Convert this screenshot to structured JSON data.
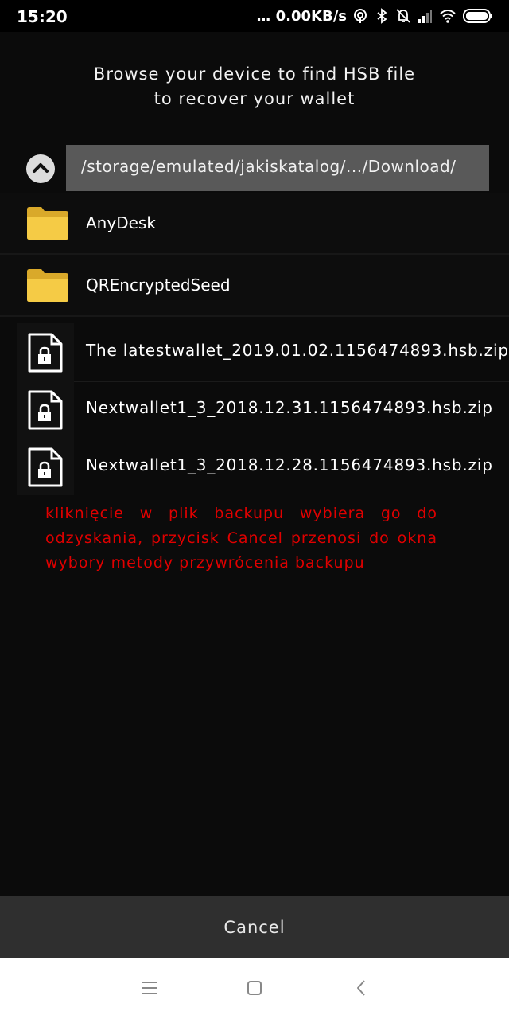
{
  "status_bar": {
    "time": "15:20",
    "dots": "...",
    "net_speed": "0.00KB/s",
    "icons": [
      "hotspot-icon",
      "bluetooth-icon",
      "notifications-off-icon",
      "signal-icon",
      "wifi-icon",
      "battery-icon"
    ]
  },
  "header": {
    "line1": "Browse your device to find HSB file",
    "line2": "to recover your wallet"
  },
  "path": {
    "up_icon": "chevron-up-icon",
    "text": "/storage/emulated/jakiskatalog/.../Download/"
  },
  "items": [
    {
      "type": "folder",
      "icon": "folder-icon",
      "name": "AnyDesk"
    },
    {
      "type": "folder",
      "icon": "folder-icon",
      "name": "QREncryptedSeed"
    },
    {
      "type": "file",
      "icon": "locked-file-icon",
      "name": "The latestwallet_2019.01.02.1156474893.hsb.zip"
    },
    {
      "type": "file",
      "icon": "locked-file-icon",
      "name": "Nextwallet1_3_2018.12.31.1156474893.hsb.zip"
    },
    {
      "type": "file",
      "icon": "locked-file-icon",
      "name": "Nextwallet1_3_2018.12.28.1156474893.hsb.zip"
    }
  ],
  "note": "kliknięcie w plik backupu wybiera go do odzyskania, przycisk Cancel przenosi do okna wybory metody przywrócenia backupu",
  "cancel_label": "Cancel",
  "nav": [
    "menu-icon",
    "home-icon",
    "back-icon"
  ],
  "colors": {
    "background": "#0b0b0b",
    "path_box": "#595959",
    "folder": "#f3c73a",
    "note": "#e00000",
    "cancel_bg": "#2f2f2f"
  }
}
